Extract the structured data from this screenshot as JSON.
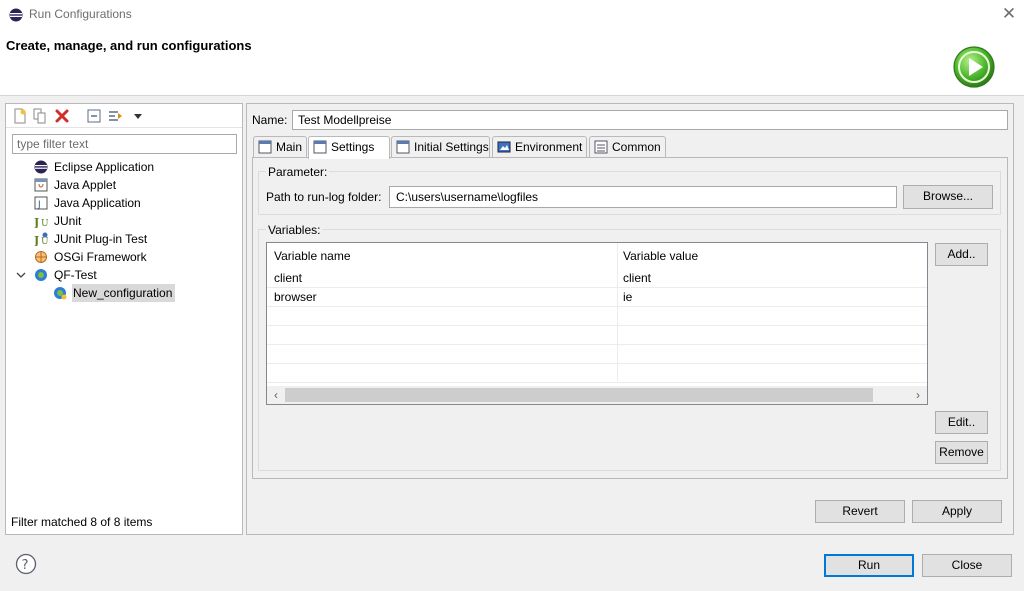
{
  "window": {
    "title": "Run Configurations",
    "header_title": "Create, manage, and run configurations"
  },
  "sidebar": {
    "filter_placeholder": "type filter text",
    "tree": [
      {
        "label": "Eclipse Application",
        "icon": "eclipse-icon"
      },
      {
        "label": "Java Applet",
        "icon": "java-applet-icon"
      },
      {
        "label": "Java Application",
        "icon": "java-application-icon"
      },
      {
        "label": "JUnit",
        "icon": "junit-icon"
      },
      {
        "label": "JUnit Plug-in Test",
        "icon": "junit-plugin-icon"
      },
      {
        "label": "OSGi Framework",
        "icon": "osgi-icon"
      },
      {
        "label": "QF-Test",
        "icon": "qftest-icon",
        "expanded": true
      },
      {
        "label": "New_configuration",
        "icon": "qftest-config-icon",
        "selected": true
      }
    ],
    "status": "Filter matched 8 of 8 items"
  },
  "config": {
    "name_label": "Name:",
    "name_value": "Test Modellpreise",
    "tabs": [
      {
        "label": "Main",
        "active": false
      },
      {
        "label": "Settings",
        "active": true
      },
      {
        "label": "Initial Settings",
        "active": false
      },
      {
        "label": "Environment",
        "active": false
      },
      {
        "label": "Common",
        "active": false
      }
    ],
    "parameter_group": "Parameter:",
    "path_label": "Path to run-log folder:",
    "path_value": "C:\\users\\username\\logfiles",
    "browse_label": "Browse...",
    "variables_group": "Variables:",
    "table": {
      "columns": [
        "Variable name",
        "Variable value"
      ],
      "rows": [
        [
          "client",
          "client"
        ],
        [
          "browser",
          "ie"
        ]
      ]
    },
    "add_label": "Add..",
    "edit_label": "Edit..",
    "remove_label": "Remove",
    "revert_label": "Revert",
    "apply_label": "Apply"
  },
  "footer": {
    "run_label": "Run",
    "close_label": "Close"
  },
  "colors": {
    "accent": "#0078d7",
    "run_green": "#3aa92c"
  }
}
